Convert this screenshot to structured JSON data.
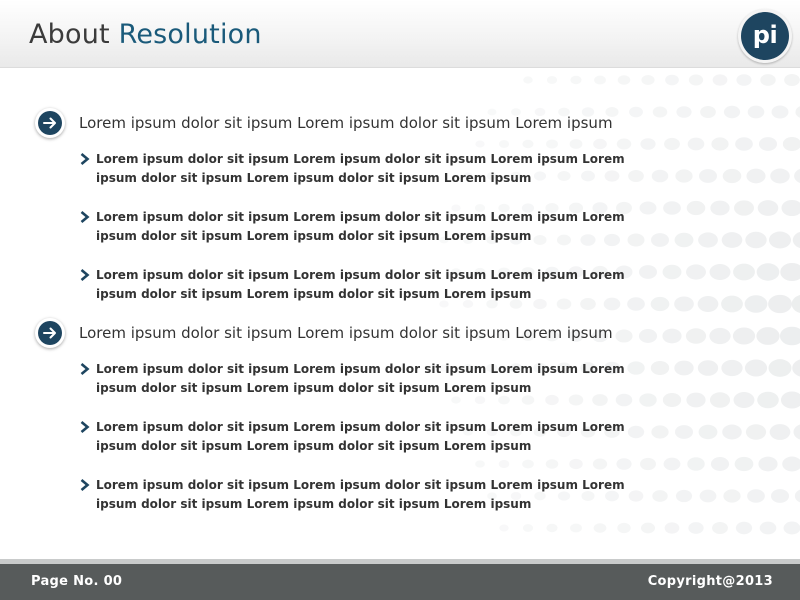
{
  "header": {
    "title_part1": "About ",
    "title_part2": "Resolution",
    "logo_text": "pi"
  },
  "sections": [
    {
      "heading": "Lorem ipsum dolor sit ipsum Lorem ipsum dolor sit ipsum Lorem ipsum",
      "bullets": [
        "Lorem ipsum dolor sit ipsum Lorem ipsum dolor sit ipsum Lorem ipsum  Lorem ipsum dolor sit ipsum Lorem ipsum dolor sit ipsum Lorem ipsum",
        "Lorem ipsum dolor sit ipsum Lorem ipsum dolor sit ipsum Lorem ipsum  Lorem ipsum dolor sit ipsum Lorem ipsum dolor sit ipsum Lorem ipsum",
        "Lorem ipsum dolor sit ipsum Lorem ipsum dolor sit ipsum Lorem ipsum  Lorem ipsum dolor sit ipsum Lorem ipsum dolor sit ipsum Lorem ipsum"
      ]
    },
    {
      "heading": "Lorem ipsum dolor sit ipsum Lorem ipsum dolor sit ipsum Lorem ipsum",
      "bullets": [
        "Lorem ipsum dolor sit ipsum Lorem ipsum dolor sit ipsum Lorem ipsum  Lorem ipsum dolor sit ipsum Lorem ipsum dolor sit ipsum Lorem ipsum",
        "Lorem ipsum dolor sit ipsum Lorem ipsum dolor sit ipsum Lorem ipsum  Lorem ipsum dolor sit ipsum Lorem ipsum dolor sit ipsum Lorem ipsum",
        "Lorem ipsum dolor sit ipsum Lorem ipsum dolor sit ipsum Lorem ipsum  Lorem ipsum dolor sit ipsum Lorem ipsum dolor sit ipsum Lorem ipsum"
      ]
    }
  ],
  "footer": {
    "page_label": "Page No. 00",
    "copyright": "Copyright@2013"
  },
  "colors": {
    "accent": "#1e4560",
    "title_accent": "#1a5a7a",
    "footer_bg": "#575b5b"
  },
  "icons": {
    "section_icon": "arrow-right-circle-icon",
    "bullet_icon": "chevron-right-icon",
    "logo": "pi-logo"
  }
}
